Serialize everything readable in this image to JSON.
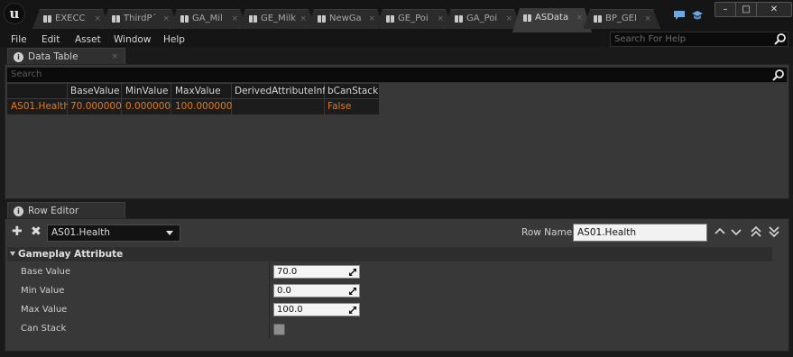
{
  "app": {
    "tabs": [
      {
        "label": "EXECC"
      },
      {
        "label": "ThirdP´"
      },
      {
        "label": "GA_Mil"
      },
      {
        "label": "GE_Milk"
      },
      {
        "label": "NewGa"
      },
      {
        "label": "GE_Poi"
      },
      {
        "label": "GA_Poi"
      },
      {
        "label": "ASData"
      },
      {
        "label": "BP_GEI"
      }
    ],
    "tab_close": "×",
    "window_buttons": {
      "minimize": "–",
      "maximize": "□",
      "close": "✕"
    }
  },
  "menu": {
    "items": [
      "File",
      "Edit",
      "Asset",
      "Window",
      "Help"
    ],
    "help_search_placeholder": "Search For Help"
  },
  "data_table": {
    "tab_label": "Data Table",
    "search_placeholder": "Search",
    "columns": [
      "BaseValue",
      "MinValue",
      "MaxValue",
      "DerivedAttributeInfo",
      "bCanStack"
    ],
    "rows": [
      {
        "name": "AS01.Health",
        "cells": [
          "70.000000",
          "0.000000",
          "100.000000",
          "",
          "False"
        ]
      }
    ]
  },
  "row_editor": {
    "tab_label": "Row Editor",
    "add_icon": "✚",
    "remove_icon": "✖",
    "selected_row": "AS01.Health",
    "row_name_label": "Row Name:",
    "row_name_value": "AS01.Health",
    "nav_icons": [
      "ⱏ",
      "˅",
      "⯬",
      "⯭"
    ],
    "section_title": "Gameplay Attribute",
    "properties": [
      {
        "label": "Base Value",
        "value": "70.0"
      },
      {
        "label": "Min Value",
        "value": "0.0"
      },
      {
        "label": "Max Value",
        "value": "100.0"
      },
      {
        "label": "Can Stack",
        "checked": false
      }
    ]
  },
  "colors": {
    "row_highlight_text": "#e07c1a",
    "panel_bg": "#383838",
    "titlebar_bg": "#151515"
  }
}
